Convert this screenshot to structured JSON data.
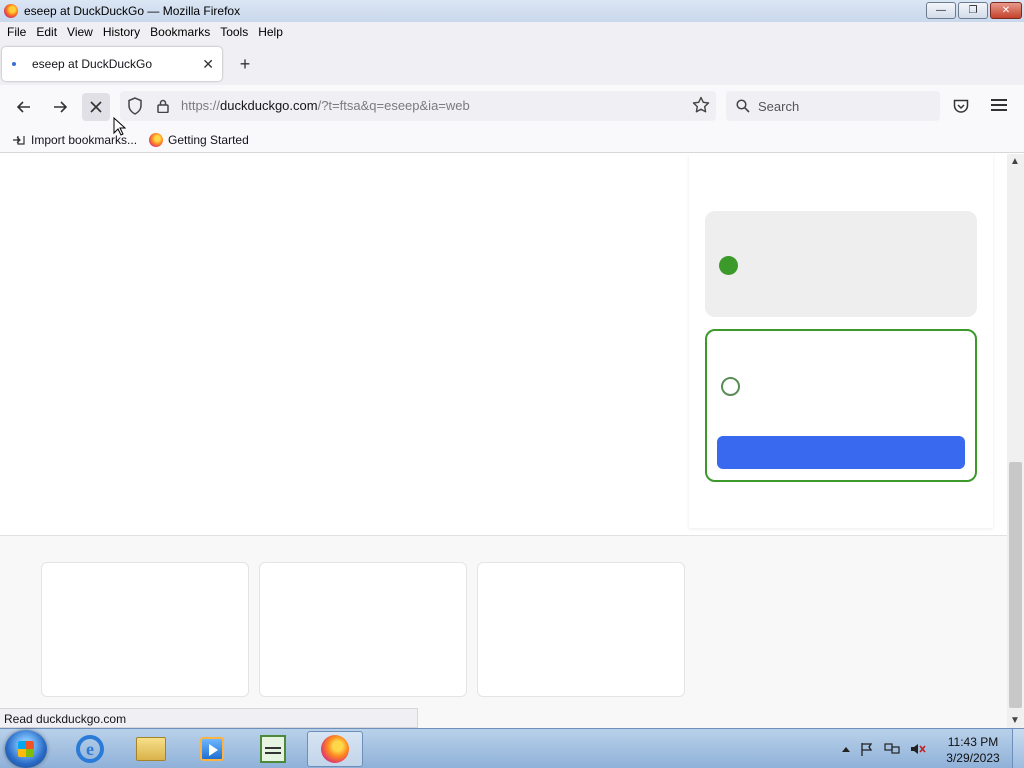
{
  "window": {
    "title": "eseep at DuckDuckGo — Mozilla Firefox",
    "controls": {
      "minimize": "—",
      "maximize": "❐",
      "close": "✕"
    }
  },
  "menubar": {
    "items": [
      {
        "label": "File"
      },
      {
        "label": "Edit"
      },
      {
        "label": "View"
      },
      {
        "label": "History"
      },
      {
        "label": "Bookmarks"
      },
      {
        "label": "Tools"
      },
      {
        "label": "Help"
      }
    ]
  },
  "tabs": [
    {
      "label": "eseep at DuckDuckGo",
      "close": "✕",
      "active": true
    }
  ],
  "newtab_label": "+",
  "navbar": {
    "back_icon": "back-arrow-icon",
    "forward_icon": "forward-arrow-icon",
    "stop_icon": "stop-icon",
    "url_prefix": "https://",
    "url_host": "duckduckgo.com",
    "url_path": "/?t=ftsa&q=eseep&ia=web",
    "search_placeholder": "Search"
  },
  "bookmarks": [
    {
      "label": "Import bookmarks...",
      "icon": "import-icon"
    },
    {
      "label": "Getting Started",
      "icon": "firefox-icon"
    }
  ],
  "status": {
    "text": "Read duckduckgo.com"
  },
  "taskbar": {
    "clock_time": "11:43 PM",
    "clock_date": "3/29/2023"
  },
  "colors": {
    "accent_green": "#3c9a2a",
    "accent_blue": "#3969ef"
  }
}
